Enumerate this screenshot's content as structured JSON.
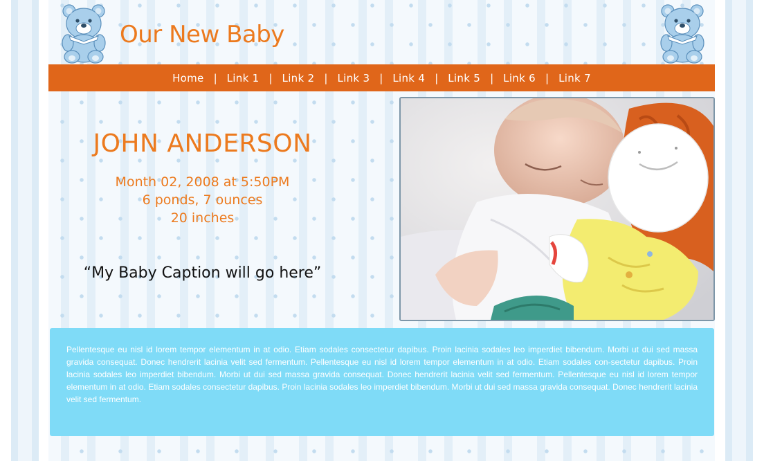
{
  "site": {
    "title": "Our New Baby"
  },
  "nav": {
    "links": [
      "Home",
      "Link 1",
      "Link 2",
      "Link 3",
      "Link 4",
      "Link 5",
      "Link 6",
      "Link 7"
    ],
    "separator": "|"
  },
  "baby": {
    "name": "JOHN ANDERSON",
    "date": "Month 02, 2008 at 5:50PM",
    "weight": "6 ponds, 7 ounces",
    "length": "20 inches",
    "caption": "“My Baby Caption will go here”"
  },
  "content": {
    "paragraph": "Pellentesque eu nisl id lorem tempor elementum in at odio. Etiam sodales consectetur dapibus. Proin lacinia sodales leo imperdiet bibendum. Morbi ut dui sed massa gravida consequat. Donec hendrerit lacinia velit sed fermentum. Pellentesque eu nisl id lorem tempor elementum in at odio. Etiam sodales con-sectetur dapibus. Proin lacinia sodales leo imperdiet bibendum. Morbi ut dui sed massa gravida consequat. Donec hendrerit lacinia velit sed fermentum. Pellentesque eu nisl id lorem tempor elementum in at odio. Etiam sodales consectetur dapibus. Proin lacinia sodales leo imperdiet bibendum. Morbi ut dui sed massa gravida consequat. Donec hendrerit lacinia velit sed fermentum."
  },
  "icons": {
    "header_left": "teddy-bear-icon",
    "header_right": "teddy-bear-icon"
  },
  "colors": {
    "accent": "#ec7a1e",
    "nav_background": "#e0661a",
    "content_box": "#7fdbf7",
    "bear_blue": "#a9cfeb"
  }
}
